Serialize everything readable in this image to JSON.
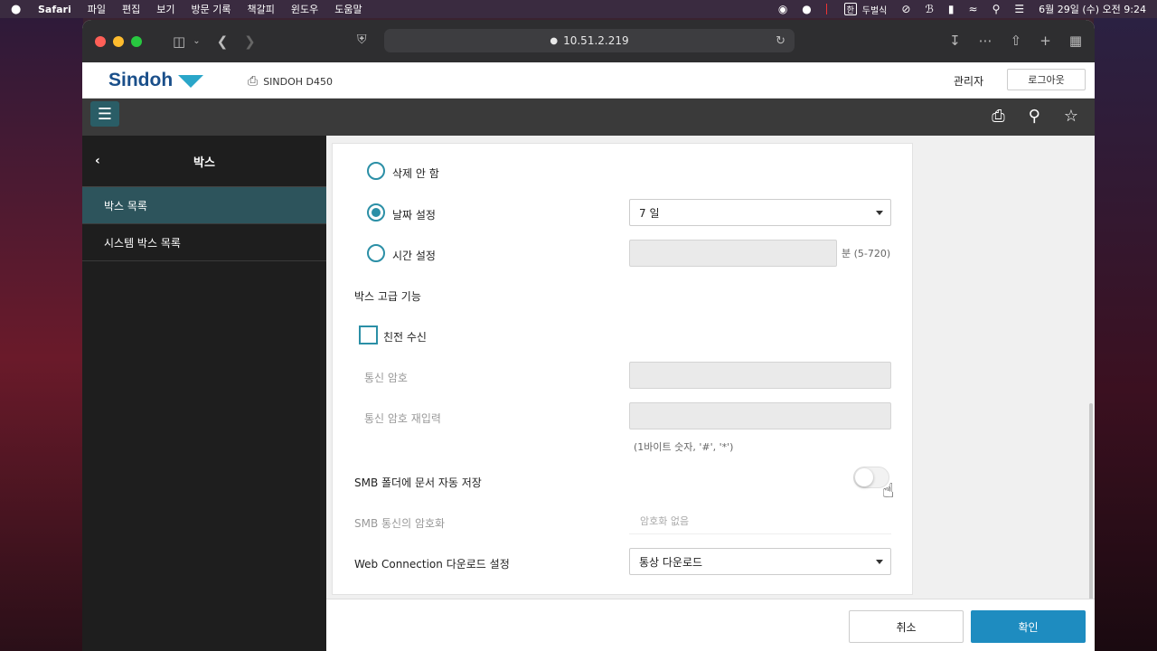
{
  "menubar": {
    "app": "Safari",
    "items": [
      "파일",
      "편집",
      "보기",
      "방문 기록",
      "책갈피",
      "윈도우",
      "도움말"
    ],
    "input_source": "두벌식",
    "han_badge": "한",
    "clock": "6월 29일 (수) 오전 9:24"
  },
  "browser": {
    "url": "10.51.2.219"
  },
  "header": {
    "logo_text": "Sindoh",
    "device_name": "SINDOH D450",
    "user_label": "관리자",
    "logout_label": "로그아웃"
  },
  "sidebar": {
    "title": "박스",
    "items": [
      {
        "label": "박스 목록",
        "active": true
      },
      {
        "label": "시스템 박스 목록",
        "active": false
      }
    ]
  },
  "form": {
    "delete_none_label": "삭제 안 함",
    "date_setting_label": "날짜 설정",
    "date_setting_value": "7 일",
    "time_setting_label": "시간 설정",
    "time_unit_hint": "분 (5-720)",
    "advanced_section_label": "박스 고급 기능",
    "relay_receive_label": "친전 수신",
    "comm_password_label": "통신 암호",
    "comm_password_confirm_label": "통신 암호 재입력",
    "password_hint": "(1바이트 숫자, '#', '*')",
    "smb_autosave_label": "SMB 폴더에 문서 자동 저장",
    "smb_encryption_label": "SMB 통신의 암호화",
    "smb_encryption_value": "암호화 없음",
    "webconn_download_label": "Web Connection 다운로드 설정",
    "webconn_download_value": "통상 다운로드"
  },
  "footer": {
    "cancel_label": "취소",
    "ok_label": "확인"
  },
  "colors": {
    "accent": "#2b8fa6",
    "primary_button": "#1e8cc0",
    "sidebar_active": "#2d545c"
  }
}
